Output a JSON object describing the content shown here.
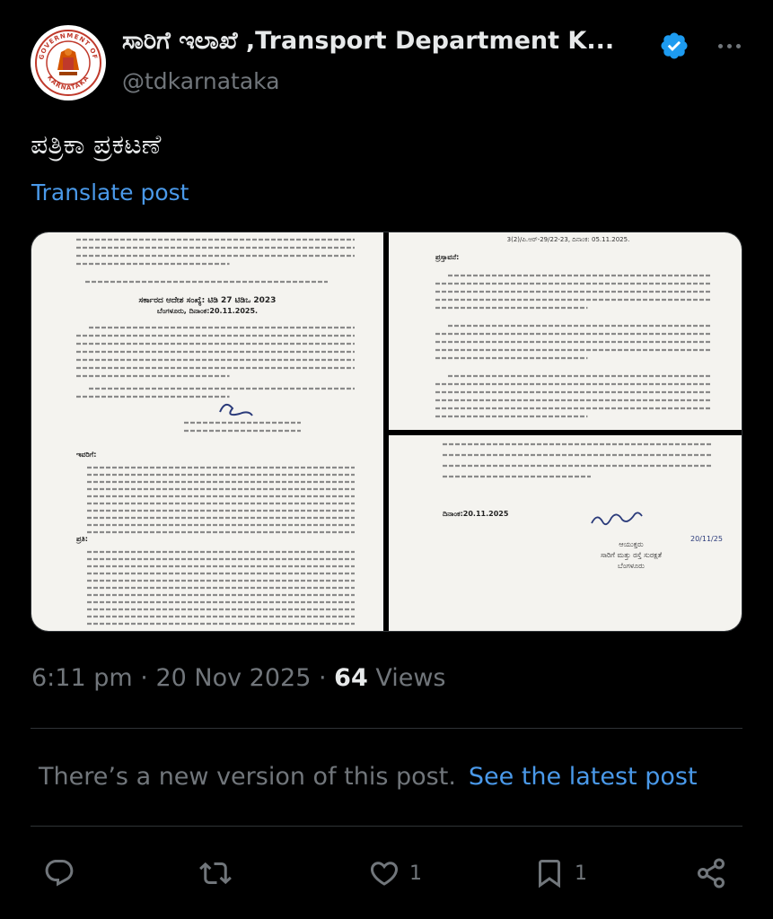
{
  "author": {
    "display_name": "ಸಾರಿಗೆ ಇಲಾಖೆ ,Transport Department K...",
    "handle": "@tdkarnataka",
    "verified": true,
    "avatar_icon": "karnataka-government-emblem",
    "avatar_ring_text_top": "GOVERNMENT OF",
    "avatar_ring_text_bottom": "KARNATAKA"
  },
  "post": {
    "text": "ಪತ್ರಿಕಾ ಪ್ರಕಟಣೆ",
    "translate_label": "Translate post",
    "time": "6:11 pm",
    "date": "20 Nov 2025",
    "separator": "·",
    "views_count": "64",
    "views_label": "Views"
  },
  "media": {
    "images": [
      "document-page-1",
      "document-page-2",
      "document-page-3"
    ],
    "doc_a": {
      "title": "ಸರ್ಕಾರದ ಆದೇಶ ಸಂಖ್ಯೆ: ಟಿಡಿ 27 ಟಿಡಿಒ 2023",
      "subtitle": "ಬೆಂಗಳೂರು, ದಿನಾಂಕ:20.11.2025.",
      "sections": [
        "ಇವರಿಗೆ:",
        "ಪ್ರತಿ:"
      ]
    },
    "doc_b": {
      "header": "3(2)/ಪಿ.ಆರ್-29/22-23, ದಿನಾಂಕ: 05.11.2025.",
      "section": "ಪ್ರಸ್ತಾವನೆ:"
    },
    "doc_c": {
      "date_line": "ದಿನಾಂಕ:20.11.2025",
      "signature_date": "20/11/25",
      "signatory": "ಆಯುಕ್ತರು",
      "signatory_office": "ಸಾರಿಗೆ ಮತ್ತು ರಸ್ತೆ ಸುರಕ್ಷತೆ",
      "signatory_city": "ಬೆಂಗಳೂರು"
    }
  },
  "notice": {
    "text": "There’s a new version of this post.",
    "link": "See the latest post"
  },
  "actions": {
    "reply_icon": "reply-icon",
    "repost_icon": "repost-icon",
    "like_icon": "heart-icon",
    "like_count": "1",
    "bookmark_icon": "bookmark-icon",
    "bookmark_count": "1",
    "share_icon": "share-icon"
  },
  "colors": {
    "background": "#000000",
    "text_primary": "#e7e9ea",
    "text_secondary": "#71767b",
    "accent_blue": "#4a99e9",
    "verified_blue": "#1d9bf0",
    "divider": "#2f3336"
  }
}
